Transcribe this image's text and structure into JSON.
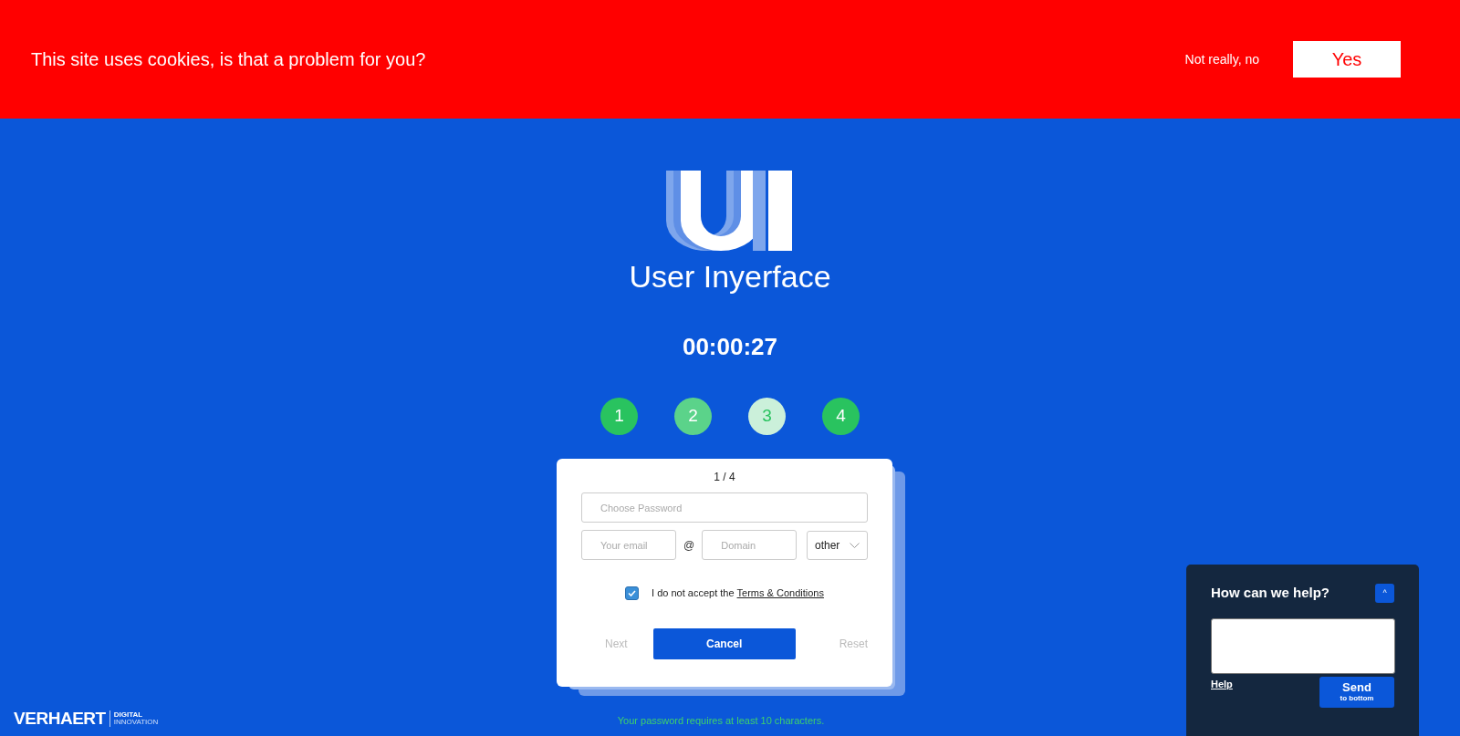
{
  "cookie_banner": {
    "message": "This site uses cookies, is that a problem for you?",
    "decline": "Not really, no",
    "accept": "Yes"
  },
  "logo": {
    "title": "User Inyerface"
  },
  "timer": "00:00:27",
  "steps": [
    {
      "label": "1",
      "color": "#29c35f",
      "current": false
    },
    {
      "label": "2",
      "color": "#5bd38a",
      "current": false
    },
    {
      "label": "3",
      "color": "#cbf0da",
      "current": true
    },
    {
      "label": "4",
      "color": "#29c35f",
      "current": false
    }
  ],
  "card": {
    "counter": "1 / 4",
    "password": {
      "placeholder": "Choose Password"
    },
    "email": {
      "placeholder": "Your email"
    },
    "at": "@",
    "domain": {
      "placeholder": "Domain"
    },
    "tld": {
      "value": "other"
    },
    "terms": {
      "checked": true,
      "text": "I do not accept the",
      "link": "Terms & Conditions"
    },
    "buttons": {
      "next": "Next",
      "cancel": "Cancel",
      "reset": "Reset"
    }
  },
  "hint": "Your password requires at least 10 characters.",
  "footer_logo": {
    "name": "VERHAERT",
    "line1": "DIGITAL",
    "line2": "INNOVATION"
  },
  "help_widget": {
    "title": "How can we help?",
    "toggle": "^",
    "help_link": "Help",
    "send": "Send",
    "send_sub": "to bottom"
  }
}
